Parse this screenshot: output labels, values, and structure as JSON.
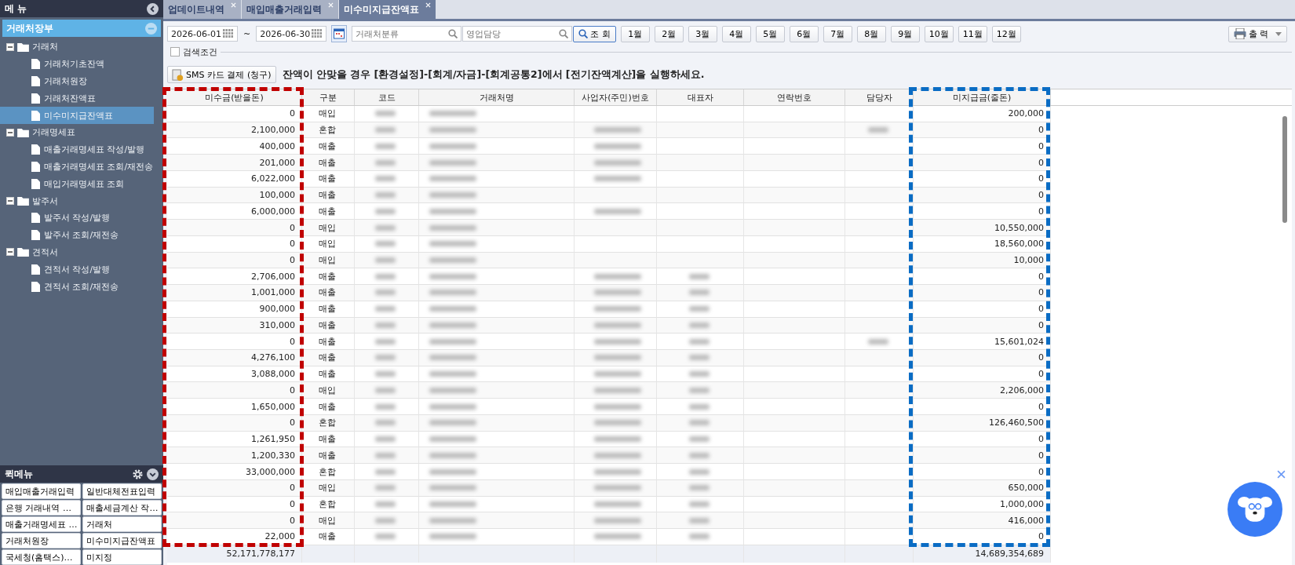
{
  "sidebar": {
    "title": "메 뉴",
    "section": "거래처장부",
    "tree": [
      {
        "label": "거래처",
        "expanded": true,
        "children": [
          {
            "label": "거래처기초잔액",
            "selected": false
          },
          {
            "label": "거래처원장",
            "selected": false
          },
          {
            "label": "거래처잔액표",
            "selected": false
          },
          {
            "label": "미수미지급잔액표",
            "selected": true
          }
        ]
      },
      {
        "label": "거래명세표",
        "expanded": true,
        "children": [
          {
            "label": "매출거래명세표 작성/발행",
            "selected": false
          },
          {
            "label": "매출거래명세표 조회/재전송",
            "selected": false
          },
          {
            "label": "매입거래명세표 조회",
            "selected": false
          }
        ]
      },
      {
        "label": "발주서",
        "expanded": true,
        "children": [
          {
            "label": "발주서 작성/발행",
            "selected": false
          },
          {
            "label": "발주서 조회/재전송",
            "selected": false
          }
        ]
      },
      {
        "label": "견적서",
        "expanded": true,
        "children": [
          {
            "label": "견적서 작성/발행",
            "selected": false
          },
          {
            "label": "견적서 조회/재전송",
            "selected": false
          }
        ]
      }
    ],
    "quick_menu": {
      "title": "퀵메뉴",
      "items": [
        "매입매출거래입력",
        "일반대체전표입력",
        "은행 거래내역 …",
        "매출세금계산 작…",
        "매출거래명세표 …",
        "거래처",
        "거래처원장",
        "미수미지급잔액표",
        "국세청(홈택스)…",
        "미지정"
      ]
    }
  },
  "tabs": [
    {
      "label": "업데이트내역",
      "selected": false
    },
    {
      "label": "매입매출거래입력",
      "selected": false
    },
    {
      "label": "미수미지급잔액표",
      "selected": true
    }
  ],
  "toolbar": {
    "date_from": "2026-06-01",
    "separator": "~",
    "date_to": "2026-06-30",
    "client_group": {
      "placeholder": "거래처분류"
    },
    "sales_rep": {
      "placeholder": "영업담당"
    },
    "search_button": "조 회",
    "months": [
      "1월",
      "2월",
      "3월",
      "4월",
      "5월",
      "6월",
      "7월",
      "8월",
      "9월",
      "10월",
      "11월",
      "12월"
    ],
    "print_button": "출 력"
  },
  "search_conditions": {
    "label": "검색조건",
    "checked": false
  },
  "sms_button": "SMS 카드 결제 (청구)",
  "notice": "잔액이 안맞을 경우 [환경설정]-[회계/자금]-[회계공통2]에서 [전기잔액계산]을 실행하세요.",
  "table": {
    "columns": [
      "미수금(받을돈)",
      "구분",
      "코드",
      "거래처명",
      "사업자(주민)번호",
      "대표자",
      "연락번호",
      "담당자",
      "미지급금(줄돈)"
    ],
    "rows": [
      {
        "receivable": "0",
        "type": "매입",
        "payable": "200,000",
        "biz_blurred": false,
        "rep_blurred": false,
        "manager_blurred": false
      },
      {
        "receivable": "2,100,000",
        "type": "혼합",
        "payable": "0",
        "biz_blurred": true,
        "rep_blurred": false,
        "manager_blurred": true
      },
      {
        "receivable": "400,000",
        "type": "매출",
        "payable": "0",
        "biz_blurred": true,
        "rep_blurred": false,
        "manager_blurred": false
      },
      {
        "receivable": "201,000",
        "type": "매출",
        "payable": "0",
        "biz_blurred": true,
        "rep_blurred": false,
        "manager_blurred": false
      },
      {
        "receivable": "6,022,000",
        "type": "매출",
        "payable": "0",
        "biz_blurred": true,
        "rep_blurred": false,
        "manager_blurred": false
      },
      {
        "receivable": "100,000",
        "type": "매출",
        "payable": "0",
        "biz_blurred": false,
        "rep_blurred": false,
        "manager_blurred": false
      },
      {
        "receivable": "6,000,000",
        "type": "매출",
        "payable": "0",
        "biz_blurred": true,
        "rep_blurred": false,
        "manager_blurred": false
      },
      {
        "receivable": "0",
        "type": "매입",
        "payable": "10,550,000",
        "biz_blurred": false,
        "rep_blurred": false,
        "manager_blurred": false
      },
      {
        "receivable": "0",
        "type": "매입",
        "payable": "18,560,000",
        "biz_blurred": false,
        "rep_blurred": false,
        "manager_blurred": false
      },
      {
        "receivable": "0",
        "type": "매입",
        "payable": "10,000",
        "biz_blurred": false,
        "rep_blurred": false,
        "manager_blurred": false
      },
      {
        "receivable": "2,706,000",
        "type": "매출",
        "payable": "0",
        "biz_blurred": true,
        "rep_blurred": true,
        "manager_blurred": false
      },
      {
        "receivable": "1,001,000",
        "type": "매출",
        "payable": "0",
        "biz_blurred": true,
        "rep_blurred": true,
        "manager_blurred": false
      },
      {
        "receivable": "900,000",
        "type": "매출",
        "payable": "0",
        "biz_blurred": true,
        "rep_blurred": true,
        "manager_blurred": false
      },
      {
        "receivable": "310,000",
        "type": "매출",
        "payable": "0",
        "biz_blurred": true,
        "rep_blurred": true,
        "manager_blurred": false
      },
      {
        "receivable": "0",
        "type": "매출",
        "payable": "15,601,024",
        "biz_blurred": true,
        "rep_blurred": true,
        "manager_blurred": true
      },
      {
        "receivable": "4,276,100",
        "type": "매출",
        "payable": "0",
        "biz_blurred": true,
        "rep_blurred": true,
        "manager_blurred": false
      },
      {
        "receivable": "3,088,000",
        "type": "매출",
        "payable": "0",
        "biz_blurred": true,
        "rep_blurred": true,
        "manager_blurred": false
      },
      {
        "receivable": "0",
        "type": "매입",
        "payable": "2,206,000",
        "biz_blurred": true,
        "rep_blurred": true,
        "manager_blurred": false
      },
      {
        "receivable": "1,650,000",
        "type": "매출",
        "payable": "0",
        "biz_blurred": true,
        "rep_blurred": true,
        "manager_blurred": false
      },
      {
        "receivable": "0",
        "type": "혼합",
        "payable": "126,460,500",
        "biz_blurred": true,
        "rep_blurred": true,
        "manager_blurred": false
      },
      {
        "receivable": "1,261,950",
        "type": "매출",
        "payable": "0",
        "biz_blurred": true,
        "rep_blurred": true,
        "manager_blurred": false
      },
      {
        "receivable": "1,200,330",
        "type": "매출",
        "payable": "0",
        "biz_blurred": true,
        "rep_blurred": true,
        "manager_blurred": false
      },
      {
        "receivable": "33,000,000",
        "type": "혼합",
        "payable": "0",
        "biz_blurred": true,
        "rep_blurred": true,
        "manager_blurred": false
      },
      {
        "receivable": "0",
        "type": "매입",
        "payable": "650,000",
        "biz_blurred": true,
        "rep_blurred": true,
        "manager_blurred": false
      },
      {
        "receivable": "0",
        "type": "혼합",
        "payable": "1,000,000",
        "biz_blurred": true,
        "rep_blurred": true,
        "manager_blurred": false
      },
      {
        "receivable": "0",
        "type": "매입",
        "payable": "416,000",
        "biz_blurred": true,
        "rep_blurred": true,
        "manager_blurred": false
      },
      {
        "receivable": "22,000",
        "type": "매출",
        "payable": "0",
        "biz_blurred": true,
        "rep_blurred": true,
        "manager_blurred": false
      }
    ],
    "totals": {
      "receivable": "52,171,778,177",
      "payable": "14,689,354,689"
    }
  }
}
